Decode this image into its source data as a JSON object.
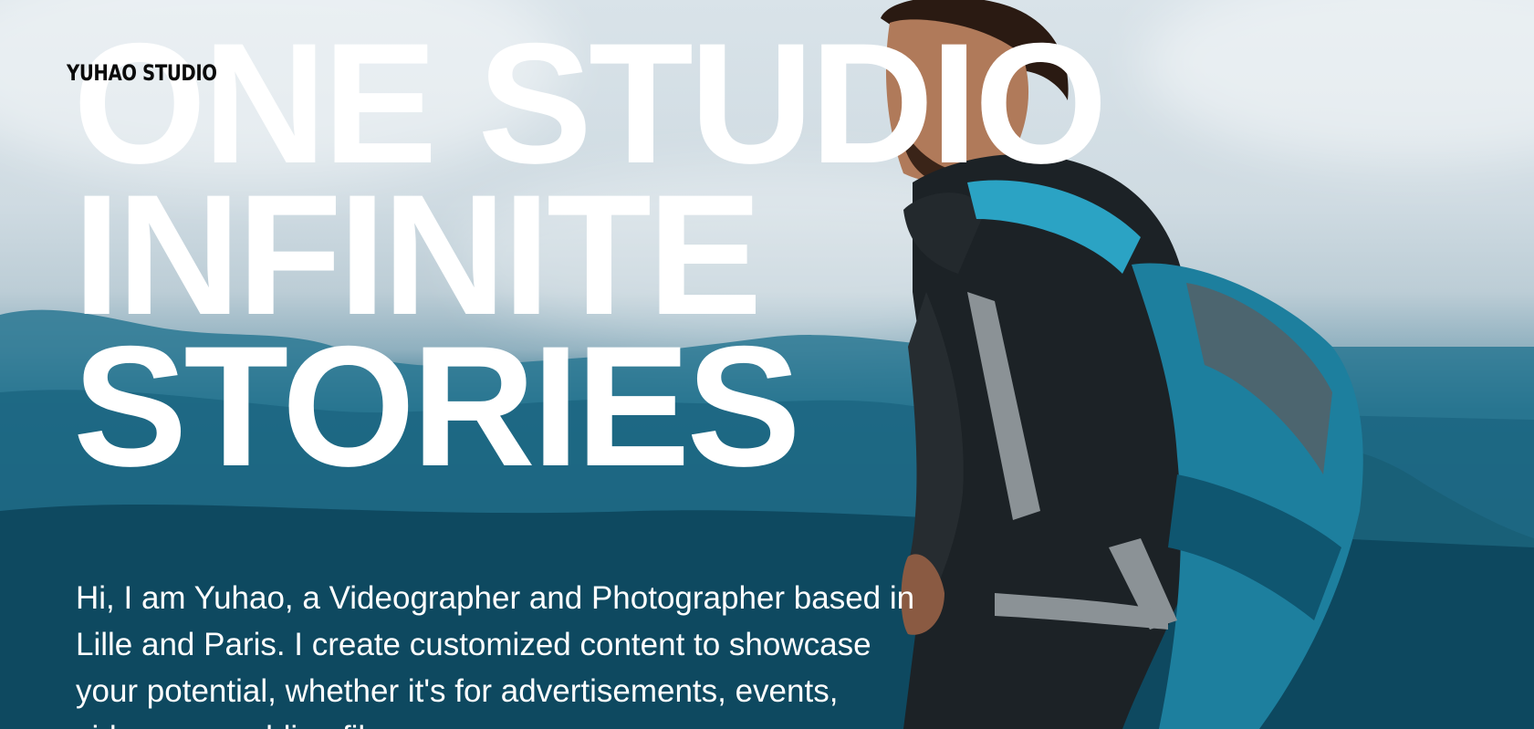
{
  "brand": {
    "logo_text": "YUHAO STUDIO"
  },
  "hero": {
    "headline_lines": [
      "ONE STUDIO",
      "INFINITE",
      "STORIES"
    ],
    "intro_text": "Hi, I am Yuhao, a Videographer and Photographer based in Lille and Paris. I create customized content to showcase your potential, whether it's for advertisements, events, videos or wedding films."
  },
  "colors": {
    "headline": "#ffffff",
    "logo": "#0a0a0a",
    "sky": "#d9e3e9",
    "mountain": "#0f5a75"
  },
  "background": {
    "image": "hiker-with-blue-backpack-over-mountains"
  }
}
